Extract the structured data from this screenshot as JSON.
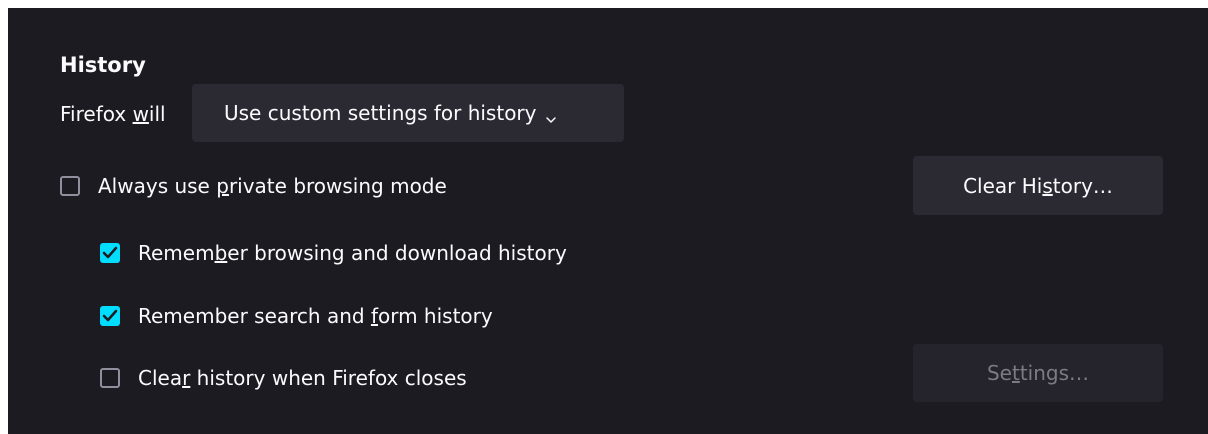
{
  "section": {
    "title": "History"
  },
  "history_mode": {
    "label_before": "Firefox ",
    "label_mnemonic": "w",
    "label_after": "ill",
    "selected_value": "Use custom settings for history"
  },
  "options": {
    "private_mode": {
      "before": "Always use ",
      "mnemonic": "p",
      "after": "rivate browsing mode",
      "checked": false
    },
    "remember_browsing": {
      "before": "Remem",
      "mnemonic": "b",
      "after": "er browsing and download history",
      "checked": true
    },
    "remember_search": {
      "before": "Remember search and ",
      "mnemonic": "f",
      "after": "orm history",
      "checked": true
    },
    "clear_on_close": {
      "before": "Clea",
      "mnemonic": "r",
      "after": " history when Firefox closes",
      "checked": false
    }
  },
  "buttons": {
    "clear_history": {
      "before": "Clear Hi",
      "mnemonic": "s",
      "after": "tory…"
    },
    "settings": {
      "before": "Se",
      "mnemonic": "t",
      "after": "tings…",
      "disabled": true
    }
  },
  "colors": {
    "background": "#1c1b22",
    "control": "#2b2a33",
    "accent": "#00ddff",
    "text": "#fbfbfe",
    "disabled_text": "#7c7b81"
  },
  "icons": {
    "dropdown": "chevron-down-icon",
    "check": "checkmark-icon"
  }
}
